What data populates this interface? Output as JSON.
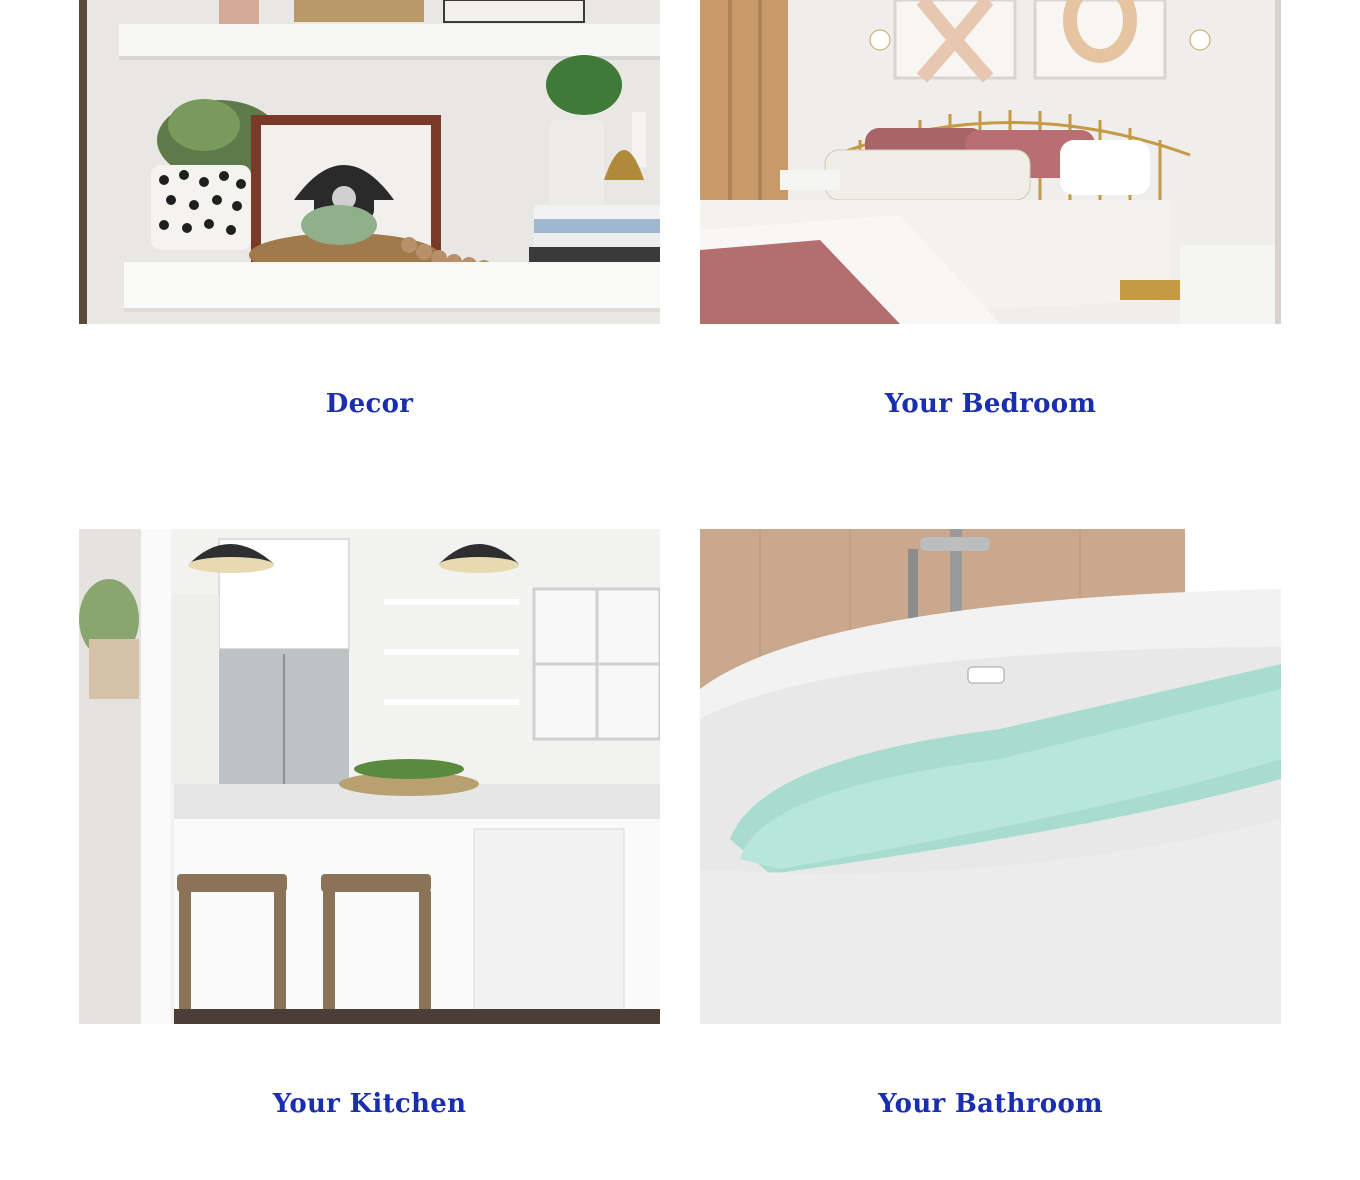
{
  "theme": {
    "title_color": "#1a2fb0"
  },
  "categories": [
    {
      "title": "Decor",
      "image_icon": "decor-shelf-photo"
    },
    {
      "title": "Your Bedroom",
      "image_icon": "bedroom-photo"
    },
    {
      "title": "Your Kitchen",
      "image_icon": "kitchen-photo"
    },
    {
      "title": "Your Bathroom",
      "image_icon": "bathtub-photo"
    }
  ]
}
